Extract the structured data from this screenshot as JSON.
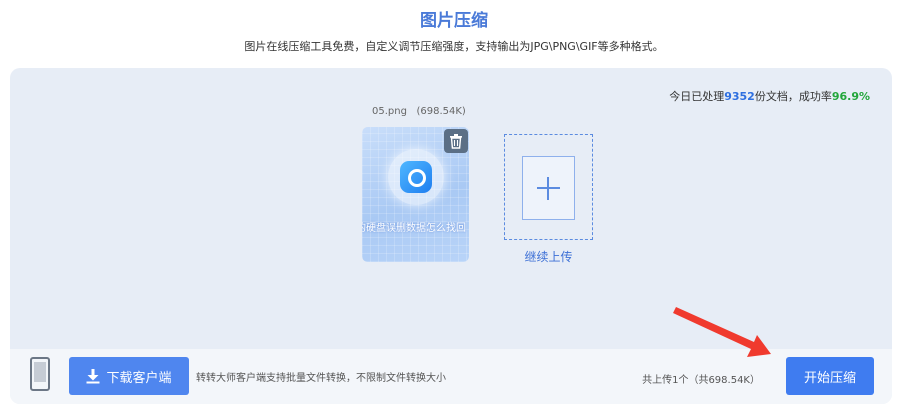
{
  "header": {
    "title": "图片压缩",
    "subtitle": "图片在线压缩工具免费，自定义调节压缩强度，支持输出为JPG\\PNG\\GIF等多种格式。"
  },
  "stats": {
    "prefix": "今日已处理",
    "processed": "9352",
    "middle": "份文档，成功率",
    "rate": "96.9%"
  },
  "file": {
    "name": "05.png",
    "size": "(698.54K)",
    "thumbnail_text": "的硬盘误删数据怎么找回",
    "delete_icon": "trash-icon"
  },
  "upload_more": {
    "label": "继续上传",
    "icon": "plus-icon"
  },
  "footer": {
    "download_button": "下载客户端",
    "download_note": "转转大师客户端支持批量文件转换，不限制文件转换大小",
    "upload_summary": "共上传1个（共698.54K）",
    "start_button": "开始压缩"
  },
  "colors": {
    "accent": "#3f7cf0",
    "title": "#4a7ad8",
    "success": "#22a63a",
    "arrow": "#f03a2e"
  }
}
